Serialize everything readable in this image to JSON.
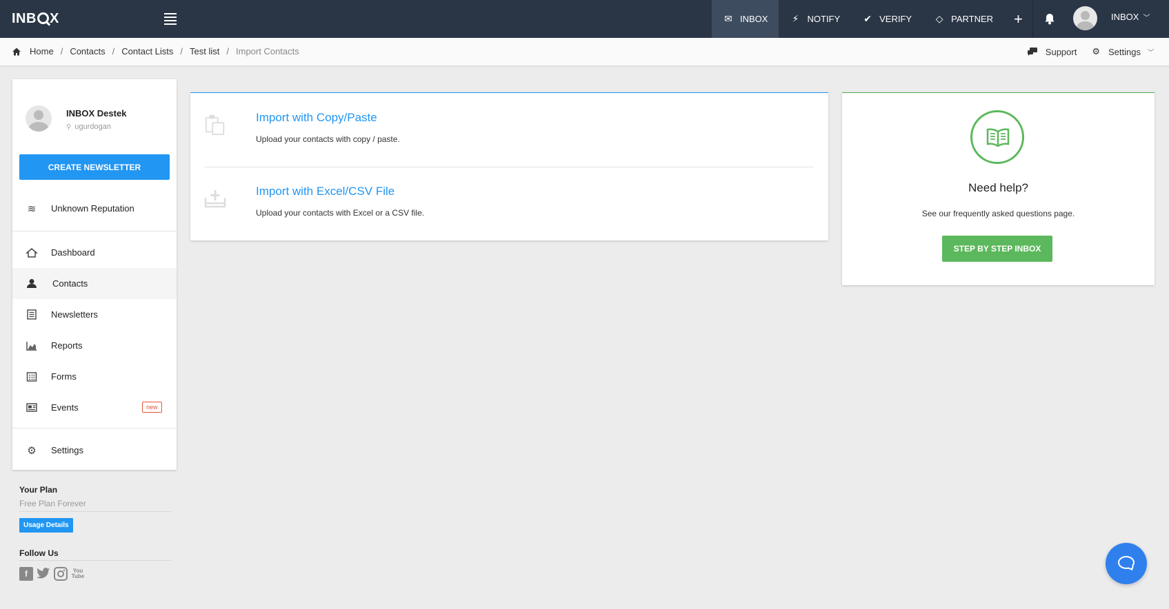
{
  "topbar": {
    "logo": "INB",
    "logo_suffix": "X",
    "nav": [
      {
        "label": "INBOX",
        "icon": "mail-icon"
      },
      {
        "label": "NOTIFY",
        "icon": "bolt-icon"
      },
      {
        "label": "VERIFY",
        "icon": "check-icon"
      },
      {
        "label": "PARTNER",
        "icon": "diamond-icon"
      }
    ],
    "plus": "+",
    "user_label": "INBOX"
  },
  "breadcrumb": {
    "items": [
      "Home",
      "Contacts",
      "Contact Lists",
      "Test list"
    ],
    "current": "Import Contacts",
    "separator": "/",
    "support_label": "Support",
    "settings_label": "Settings"
  },
  "sidebar": {
    "profile_name": "INBOX Destek",
    "profile_user": "ugurdogan",
    "create_button": "CREATE NEWSLETTER",
    "reputation": "Unknown Reputation",
    "items": [
      {
        "label": "Dashboard",
        "icon": "home-icon"
      },
      {
        "label": "Contacts",
        "icon": "contacts-icon"
      },
      {
        "label": "Newsletters",
        "icon": "newsletter-icon"
      },
      {
        "label": "Reports",
        "icon": "chart-icon"
      },
      {
        "label": "Forms",
        "icon": "form-icon"
      },
      {
        "label": "Events",
        "icon": "events-icon",
        "badge": "new"
      }
    ],
    "settings": "Settings",
    "active_index": 1
  },
  "plan": {
    "title": "Your Plan",
    "name": "Free Plan Forever",
    "usage_button": "Usage Details",
    "follow_title": "Follow Us",
    "youtube_text": "You Tube"
  },
  "import": {
    "options": [
      {
        "title": "Import with Copy/Paste",
        "desc": "Upload your contacts with copy / paste.",
        "icon": "copy-icon"
      },
      {
        "title": "Import with Excel/CSV File",
        "desc": "Upload your contacts with Excel or a CSV file.",
        "icon": "upload-icon"
      }
    ]
  },
  "help": {
    "title": "Need help?",
    "desc": "See our frequently asked questions page.",
    "button": "STEP BY STEP INBOX",
    "icon": "book-icon"
  },
  "colors": {
    "navbar": "#2a3646",
    "primary": "#2196f3",
    "success": "#5cb85c",
    "badge": "#e5533b",
    "chat": "#2f80ed"
  }
}
